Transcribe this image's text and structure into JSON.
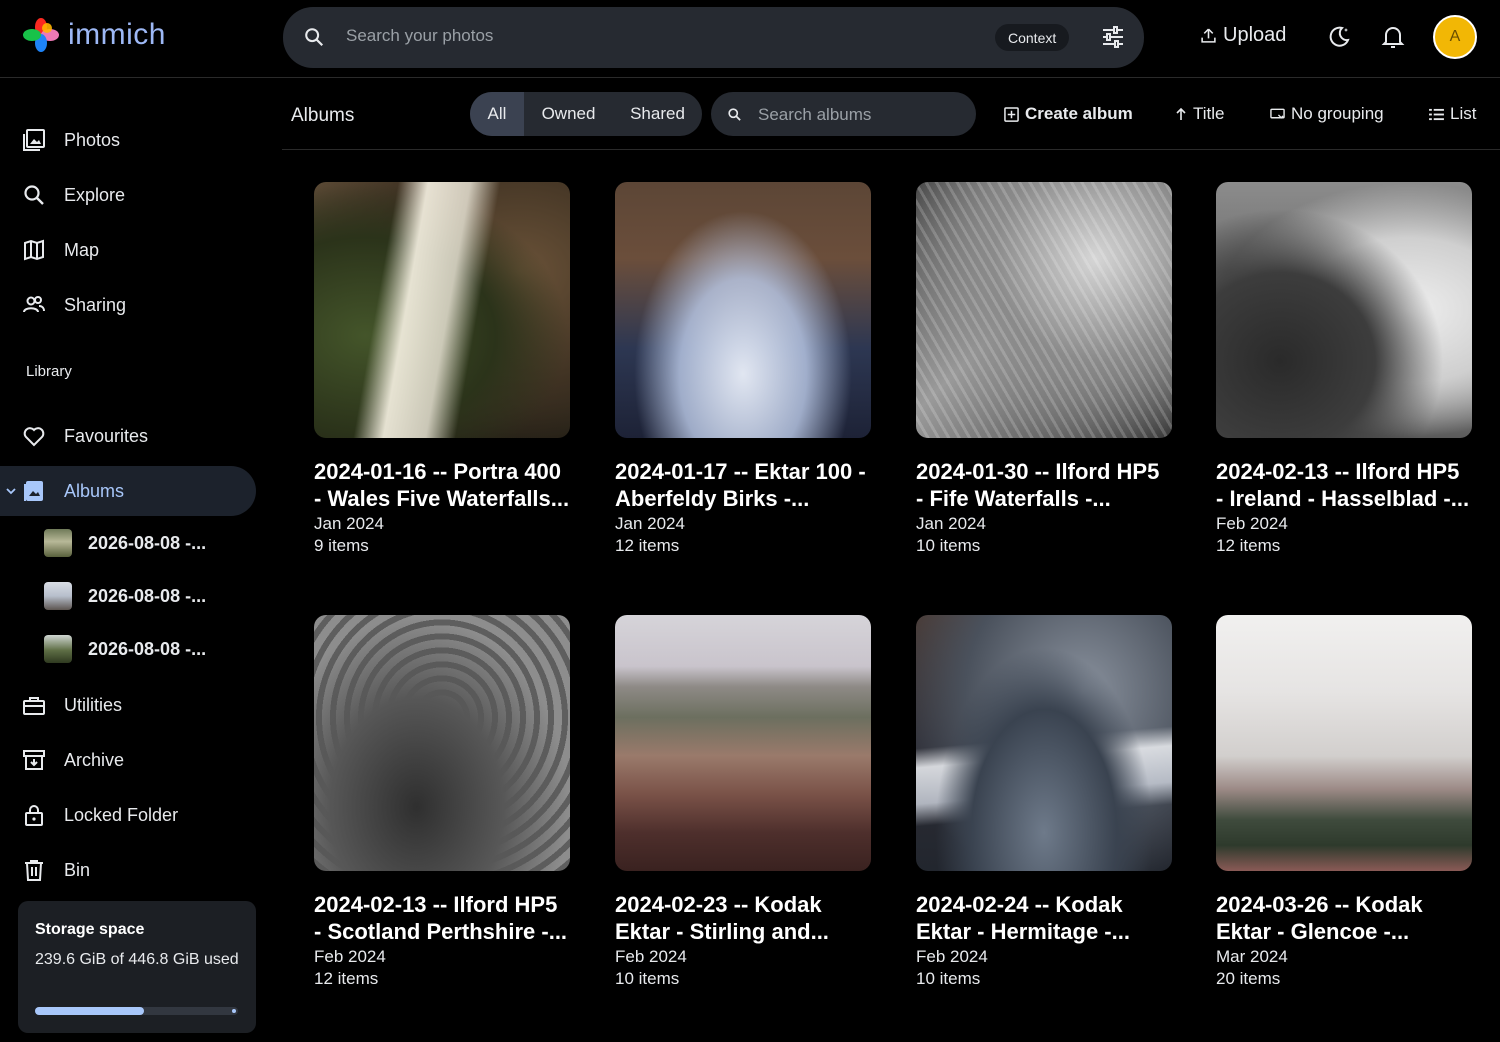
{
  "app": {
    "name": "immich"
  },
  "header": {
    "search_placeholder": "Search your photos",
    "context_label": "Context",
    "upload_label": "Upload",
    "avatar_initial": "A"
  },
  "sidebar": {
    "items": [
      {
        "label": "Photos",
        "icon": "photos-icon"
      },
      {
        "label": "Explore",
        "icon": "search-icon"
      },
      {
        "label": "Map",
        "icon": "map-icon"
      },
      {
        "label": "Sharing",
        "icon": "people-icon"
      }
    ],
    "library_label": "Library",
    "library_items": [
      {
        "label": "Favourites",
        "icon": "heart-icon"
      },
      {
        "label": "Albums",
        "icon": "album-icon",
        "active": true
      }
    ],
    "sub_albums": [
      {
        "label": "2026-08-08 -..."
      },
      {
        "label": "2026-08-08 -..."
      },
      {
        "label": "2026-08-08 -..."
      }
    ],
    "more_items": [
      {
        "label": "Utilities",
        "icon": "toolbox-icon"
      },
      {
        "label": "Archive",
        "icon": "archive-icon"
      },
      {
        "label": "Locked Folder",
        "icon": "lock-icon"
      },
      {
        "label": "Bin",
        "icon": "trash-icon"
      }
    ],
    "storage": {
      "title": "Storage space",
      "usage": "239.6 GiB of 446.8 GiB used",
      "fraction": 0.536
    }
  },
  "toolbar": {
    "title": "Albums",
    "filters": [
      "All",
      "Owned",
      "Shared"
    ],
    "active_filter": "All",
    "search_placeholder": "Search albums",
    "create_label": "Create album",
    "sort_label": "Title",
    "grouping_label": "No grouping",
    "view_label": "List"
  },
  "albums": [
    {
      "title": "2024-01-16 -- Portra 400 - Wales Five Waterfalls...",
      "date": "Jan 2024",
      "count": "9 items"
    },
    {
      "title": "2024-01-17 -- Ektar 100 - Aberfeldy Birks -...",
      "date": "Jan 2024",
      "count": "12 items"
    },
    {
      "title": "2024-01-30 -- Ilford HP5 - Fife Waterfalls -...",
      "date": "Jan 2024",
      "count": "10 items"
    },
    {
      "title": "2024-02-13 -- Ilford HP5 - Ireland - Hasselblad -...",
      "date": "Feb 2024",
      "count": "12 items"
    },
    {
      "title": "2024-02-13 -- Ilford HP5 - Scotland Perthshire -...",
      "date": "Feb 2024",
      "count": "12 items"
    },
    {
      "title": "2024-02-23 -- Kodak Ektar - Stirling and...",
      "date": "Feb 2024",
      "count": "10 items"
    },
    {
      "title": "2024-02-24 -- Kodak Ektar - Hermitage -...",
      "date": "Feb 2024",
      "count": "10 items"
    },
    {
      "title": "2024-03-26 -- Kodak Ektar - Glencoe -...",
      "date": "Mar 2024",
      "count": "20 items"
    }
  ]
}
